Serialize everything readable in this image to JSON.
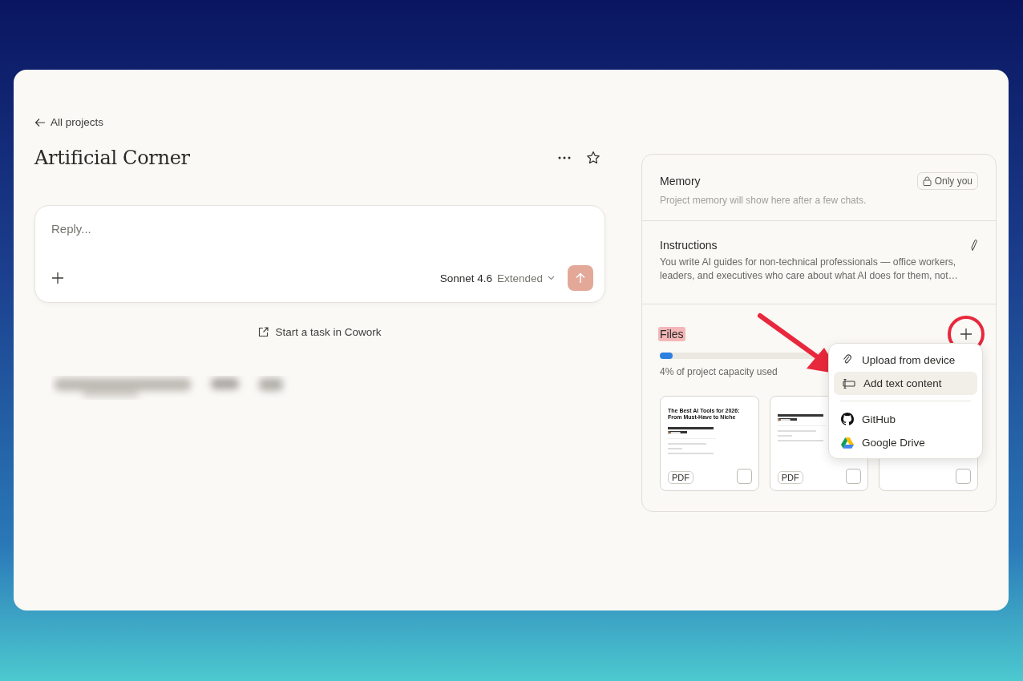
{
  "back_link": "All projects",
  "project_title": "Artificial Corner",
  "composer": {
    "placeholder": "Reply...",
    "model": "Sonnet 4.6",
    "mode": "Extended"
  },
  "cowork_link": "Start a task in Cowork",
  "memory": {
    "title": "Memory",
    "visibility": "Only you",
    "note": "Project memory will show here after a few chats."
  },
  "instructions": {
    "title": "Instructions",
    "text": "You write AI guides for non-technical professionals — office workers, leaders, and executives who care about what AI does for them, not…"
  },
  "files": {
    "title": "Files",
    "highlighted": true,
    "level": 0.04,
    "capacity": "4% of project capacity used",
    "cards": [
      {
        "title": "The Best AI Tools for 2026: From Must-Have to Niche",
        "badge": "PDF",
        "checked": false
      },
      {
        "badge": "PDF",
        "checked": false
      },
      {
        "checked": false
      }
    ]
  },
  "add_menu": {
    "items": [
      {
        "kind": "upload",
        "label": "Upload from device",
        "selected": false
      },
      {
        "kind": "text",
        "label": "Add text content",
        "selected": true
      },
      {
        "kind": "divider"
      },
      {
        "kind": "github",
        "label": "GitHub",
        "selected": false
      },
      {
        "kind": "drive",
        "label": "Google Drive",
        "selected": false
      }
    ]
  }
}
